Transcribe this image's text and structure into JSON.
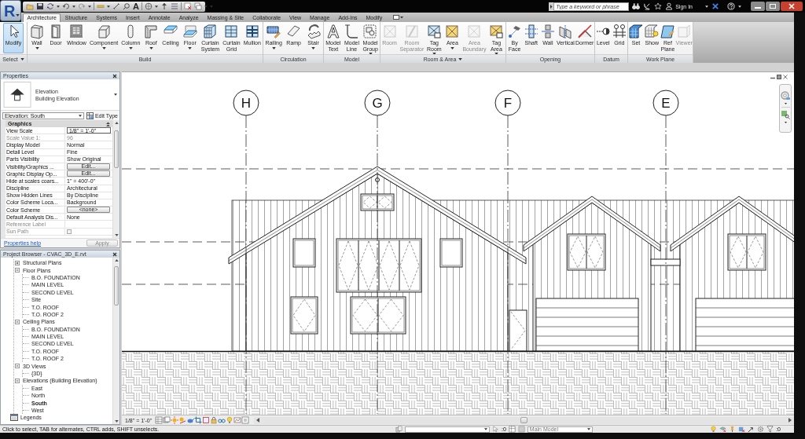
{
  "title_bar": {
    "logo": "R",
    "text_tool": "A",
    "search": {
      "placeholder": "Type a keyword or phrase"
    },
    "sign_in": "Sign In"
  },
  "tabs": [
    {
      "label": "Architecture",
      "selected": true
    },
    {
      "label": "Structure",
      "selected": false
    },
    {
      "label": "Systems",
      "selected": false
    },
    {
      "label": "Insert",
      "selected": false
    },
    {
      "label": "Annotate",
      "selected": false
    },
    {
      "label": "Analyze",
      "selected": false
    },
    {
      "label": "Massing & Site",
      "selected": false
    },
    {
      "label": "Collaborate",
      "selected": false
    },
    {
      "label": "View",
      "selected": false
    },
    {
      "label": "Manage",
      "selected": false
    },
    {
      "label": "Add-Ins",
      "selected": false
    },
    {
      "label": "Modify",
      "selected": false
    }
  ],
  "ribbon": [
    {
      "title": "Select",
      "menu": true,
      "tools": [
        {
          "label": "Modify",
          "active": true,
          "disabled": false,
          "dropdown": false
        }
      ]
    },
    {
      "title": "Build",
      "menu": false,
      "tools": [
        {
          "label": "Wall",
          "active": false,
          "disabled": false,
          "dropdown": true
        },
        {
          "label": "Door",
          "active": false,
          "disabled": false,
          "dropdown": false
        },
        {
          "label": "Window",
          "active": false,
          "disabled": false,
          "dropdown": false
        },
        {
          "label": "Component",
          "active": false,
          "disabled": false,
          "dropdown": true
        },
        {
          "label": "Column",
          "active": false,
          "disabled": false,
          "dropdown": true
        },
        {
          "label": "Roof",
          "active": false,
          "disabled": false,
          "dropdown": true
        },
        {
          "label": "Ceiling",
          "active": false,
          "disabled": false,
          "dropdown": false
        },
        {
          "label": "Floor",
          "active": false,
          "disabled": false,
          "dropdown": true
        },
        {
          "label": "Curtain System",
          "active": false,
          "disabled": false,
          "dropdown": false
        },
        {
          "label": "Curtain Grid",
          "active": false,
          "disabled": false,
          "dropdown": false
        },
        {
          "label": "Mullion",
          "active": false,
          "disabled": false,
          "dropdown": false
        }
      ]
    },
    {
      "title": "Circulation",
      "menu": false,
      "tools": [
        {
          "label": "Railing",
          "active": false,
          "disabled": false,
          "dropdown": true
        },
        {
          "label": "Ramp",
          "active": false,
          "disabled": false,
          "dropdown": false
        },
        {
          "label": "Stair",
          "active": false,
          "disabled": false,
          "dropdown": true
        }
      ]
    },
    {
      "title": "Model",
      "menu": false,
      "tools": [
        {
          "label": "Model Text",
          "active": false,
          "disabled": false,
          "dropdown": false
        },
        {
          "label": "Model Line",
          "active": false,
          "disabled": false,
          "dropdown": false
        },
        {
          "label": "Model Group",
          "active": false,
          "disabled": false,
          "dropdown": true
        }
      ]
    },
    {
      "title": "Room & Area",
      "menu": true,
      "tools": [
        {
          "label": "Room",
          "active": false,
          "disabled": true,
          "dropdown": false
        },
        {
          "label": "Room Separator",
          "active": false,
          "disabled": true,
          "dropdown": false
        },
        {
          "label": "Tag Room",
          "active": false,
          "disabled": false,
          "dropdown": true
        },
        {
          "label": "Area",
          "active": false,
          "disabled": false,
          "dropdown": true
        },
        {
          "label": "Area Boundary",
          "active": false,
          "disabled": true,
          "dropdown": false
        },
        {
          "label": "Tag Area",
          "active": false,
          "disabled": false,
          "dropdown": true
        }
      ]
    },
    {
      "title": "Opening",
      "menu": false,
      "tools": [
        {
          "label": "By Face",
          "active": false,
          "disabled": false,
          "dropdown": false
        },
        {
          "label": "Shaft",
          "active": false,
          "disabled": false,
          "dropdown": false
        },
        {
          "label": "Wall",
          "active": false,
          "disabled": false,
          "dropdown": false
        },
        {
          "label": "Vertical",
          "active": false,
          "disabled": false,
          "dropdown": false
        },
        {
          "label": "Dormer",
          "active": false,
          "disabled": false,
          "dropdown": false
        }
      ]
    },
    {
      "title": "Datum",
      "menu": false,
      "tools": [
        {
          "label": "Level",
          "active": false,
          "disabled": false,
          "dropdown": false
        },
        {
          "label": "Grid",
          "active": false,
          "disabled": false,
          "dropdown": false
        }
      ]
    },
    {
      "title": "Work Plane",
      "menu": false,
      "tools": [
        {
          "label": "Set",
          "active": false,
          "disabled": false,
          "dropdown": false
        },
        {
          "label": "Show",
          "active": false,
          "disabled": false,
          "dropdown": false
        },
        {
          "label": "Ref Plane",
          "active": false,
          "disabled": false,
          "dropdown": false
        },
        {
          "label": "Viewer",
          "active": false,
          "disabled": true,
          "dropdown": false
        }
      ]
    }
  ],
  "properties": {
    "title": "Properties",
    "type": {
      "family": "Elevation",
      "name": "Building Elevation"
    },
    "view_selector": "Elevation: South",
    "edit_type": "Edit Type",
    "group": {
      "title": "Graphics",
      "expanded": true
    },
    "rows": [
      {
        "name": "View Scale",
        "value": "1/8\" = 1'-0\"",
        "kind": "field",
        "disabled": false
      },
      {
        "name": "Scale Value 1:",
        "value": "96",
        "kind": "text",
        "disabled": true
      },
      {
        "name": "Display Model",
        "value": "Normal",
        "kind": "text",
        "disabled": false
      },
      {
        "name": "Detail Level",
        "value": "Fine",
        "kind": "text",
        "disabled": false
      },
      {
        "name": "Parts Visibility",
        "value": "Show Original",
        "kind": "text",
        "disabled": false
      },
      {
        "name": "Visibility/Graphics ...",
        "value": "Edit...",
        "kind": "button",
        "disabled": false
      },
      {
        "name": "Graphic Display Op...",
        "value": "Edit...",
        "kind": "button",
        "disabled": false
      },
      {
        "name": "Hide at scales coars...",
        "value": "1\" = 400'-0\"",
        "kind": "text",
        "disabled": false
      },
      {
        "name": "Discipline",
        "value": "Architectural",
        "kind": "text",
        "disabled": false
      },
      {
        "name": "Show Hidden Lines",
        "value": "By Discipline",
        "kind": "text",
        "disabled": false
      },
      {
        "name": "Color Scheme Loca...",
        "value": "Background",
        "kind": "text",
        "disabled": false
      },
      {
        "name": "Color Scheme",
        "value": "<none>",
        "kind": "button",
        "disabled": false
      },
      {
        "name": "Default Analysis Dis...",
        "value": "None",
        "kind": "text",
        "disabled": false
      },
      {
        "name": "Reference Label",
        "kind": "text",
        "disabled": true
      },
      {
        "name": "Sun Path",
        "kind": "checkbox",
        "checked": false,
        "disabled": true
      }
    ],
    "help_link": "Properties help",
    "apply": {
      "label": "Apply",
      "disabled": true
    }
  },
  "project_browser": {
    "title": "Project Browser - CVAC_3D_E.rvt",
    "tree": [
      {
        "children": [
          {
            "label": "Structural Plans",
            "expanded": false,
            "selected": false
          },
          {
            "label": "Floor Plans",
            "expanded": true,
            "selected": false,
            "children": [
              {
                "label": "B.O. FOUNDATION",
                "selected": false
              },
              {
                "label": "MAIN LEVEL",
                "selected": false
              },
              {
                "label": "SECOND LEVEL",
                "selected": false
              },
              {
                "label": "Site",
                "selected": false
              },
              {
                "label": "T.O. ROOF",
                "selected": false
              },
              {
                "label": "T.O. ROOF 2",
                "selected": false
              }
            ]
          },
          {
            "label": "Ceiling Plans",
            "expanded": true,
            "selected": false,
            "children": [
              {
                "label": "B.O. FOUNDATION",
                "selected": false
              },
              {
                "label": "MAIN LEVEL",
                "selected": false
              },
              {
                "label": "SECOND LEVEL",
                "selected": false
              },
              {
                "label": "T.O. ROOF",
                "selected": false
              },
              {
                "label": "T.O. ROOF 2",
                "selected": false
              }
            ]
          },
          {
            "label": "3D Views",
            "expanded": true,
            "selected": false,
            "children": [
              {
                "label": "{3D}",
                "selected": false
              }
            ]
          },
          {
            "label": "Elevations (Building Elevation)",
            "expanded": true,
            "selected": false,
            "children": [
              {
                "label": "East",
                "selected": false
              },
              {
                "label": "North",
                "selected": false
              },
              {
                "label": "South",
                "selected": true
              },
              {
                "label": "West",
                "selected": false
              }
            ]
          }
        ]
      },
      {
        "label": "Legends",
        "selected": false
      }
    ]
  },
  "view": {
    "grids": [
      {
        "label": "H"
      },
      {
        "label": "G"
      },
      {
        "label": "F"
      },
      {
        "label": "E"
      }
    ],
    "scale": "1/8\" = 1'-0\""
  },
  "status_bar": {
    "message": "Click to select, TAB for alternates, CTRL adds, SHIFT unselects.",
    "selection_count": ":0",
    "design_option": "Main Model",
    "filter_count": ":0"
  }
}
